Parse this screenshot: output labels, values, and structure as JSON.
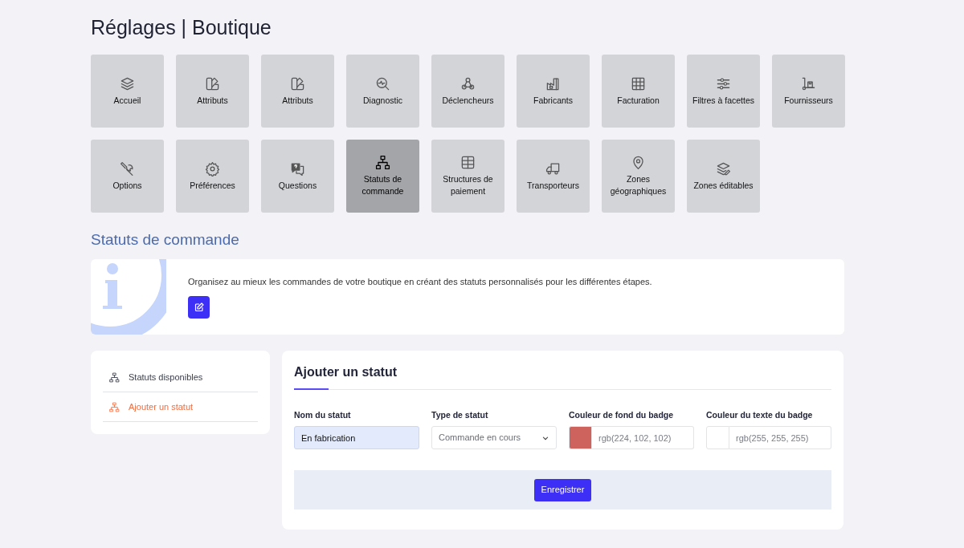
{
  "page_title": "Réglages | Boutique",
  "tiles": [
    {
      "label": "Accueil",
      "selected": false
    },
    {
      "label": "Attributs",
      "selected": false
    },
    {
      "label": "Attributs",
      "selected": false
    },
    {
      "label": "Diagnostic",
      "selected": false
    },
    {
      "label": "Déclencheurs",
      "selected": false
    },
    {
      "label": "Fabricants",
      "selected": false
    },
    {
      "label": "Facturation",
      "selected": false
    },
    {
      "label": "Filtres à facettes",
      "selected": false
    },
    {
      "label": "Fournisseurs",
      "selected": false
    },
    {
      "label": "Options",
      "selected": false
    },
    {
      "label": "Préférences",
      "selected": false
    },
    {
      "label": "Questions",
      "selected": false
    },
    {
      "label": "Statuts de commande",
      "selected": true
    },
    {
      "label": "Structures de paiement",
      "selected": false
    },
    {
      "label": "Transporteurs",
      "selected": false
    },
    {
      "label": "Zones géographiques",
      "selected": false
    },
    {
      "label": "Zones éditables",
      "selected": false
    }
  ],
  "section_title": "Statuts de commande",
  "info": {
    "text": "Organisez au mieux les commandes de votre boutique en créant des statuts personnalisés pour les différentes étapes."
  },
  "sidebar": {
    "items": [
      {
        "label": "Statuts disponibles",
        "selected": false
      },
      {
        "label": "Ajouter un statut",
        "selected": true
      }
    ]
  },
  "form": {
    "title": "Ajouter un statut",
    "fields": [
      {
        "kind": "text",
        "label": "Nom du statut",
        "value": "En fabrication",
        "focused": true
      },
      {
        "kind": "select",
        "label": "Type de statut",
        "value": "Commande en cours"
      },
      {
        "kind": "color",
        "label": "Couleur de fond du badge",
        "placeholder": "rgb(224, 102, 102)",
        "color": "#cd635c"
      },
      {
        "kind": "color",
        "label": "Couleur du texte du badge",
        "placeholder": "rgb(255, 255, 255)",
        "color": "#ffffff"
      }
    ],
    "submit": "Enregistrer"
  }
}
